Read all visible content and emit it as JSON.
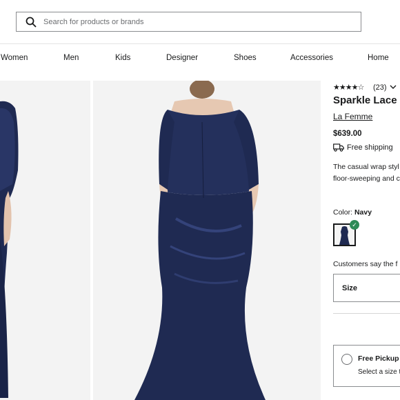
{
  "search": {
    "placeholder": "Search for products or brands"
  },
  "nav": [
    "Women",
    "Men",
    "Kids",
    "Designer",
    "Shoes",
    "Accessories",
    "Home"
  ],
  "product": {
    "rating_stars": "★★★★☆",
    "review_count": "(23)",
    "title": "Sparkle Lace",
    "brand": "La Femme",
    "price": "$639.00",
    "shipping": "Free shipping",
    "description": "The casual wrap styl elegance that begins floor-sweeping and c",
    "color_label": "Color:",
    "color_value": "Navy",
    "customers_say": "Customers say the f",
    "size_label": "Size",
    "pickup_title": "Free Pickup",
    "pickup_sub": "Select a size to"
  },
  "colors": {
    "dress": "#1f2a52",
    "dress_light": "#2c3a6b",
    "check": "#2e8b57",
    "background": "#f3f3f3"
  },
  "icons": [
    "search-icon",
    "truck-icon",
    "chevron-down-icon",
    "check-icon"
  ]
}
